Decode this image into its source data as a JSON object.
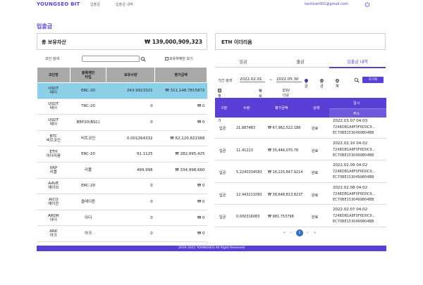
{
  "header": {
    "logo": "YOUNGSEO BIT",
    "nav": [
      "입출금",
      "입출금 내역"
    ],
    "email": "testUser001@gmail.com"
  },
  "page_title": "입출금",
  "left": {
    "total_assets_label": "총 보유자산",
    "total_assets_value": "₩ 139,000,909,323",
    "search_label": "코인 검색",
    "search_value": "",
    "holdings_only_label": "보유하에만 보기",
    "columns": [
      "코인명",
      "블록체인\n타입",
      "보유수량",
      "평가금액"
    ],
    "rows": [
      {
        "name": "USDT\n테더",
        "chain": "ERC-20",
        "qty": "243.9923321",
        "value": "₩ 311,148.7815872",
        "selected": true
      },
      {
        "name": "USDT\n테더",
        "chain": "TRC-20",
        "qty": "0",
        "value": "₩ 0",
        "selected": false
      },
      {
        "name": "USDT\n테더",
        "chain": "BEP20(BSC)",
        "qty": "0",
        "value": "₩ 0",
        "selected": false
      },
      {
        "name": "BTC\n비트코인",
        "chain": "비트코인",
        "qty": "0.001264332",
        "value": "₩ 62,120.822368",
        "selected": false
      },
      {
        "name": "ETH\n이더리움",
        "chain": "ERC-20",
        "qty": "91.1125",
        "value": "₩ 282,995,425",
        "selected": false
      },
      {
        "name": "XRP\n리플",
        "chain": "리플",
        "qty": "499,998",
        "value": "₩ 334,998,660",
        "selected": false
      },
      {
        "name": "AAVE\n에이브",
        "chain": "ERC-20",
        "qty": "0",
        "value": "₩ 0",
        "selected": false
      },
      {
        "name": "AICO\n에이콘",
        "chain": "클레이튼",
        "qty": "0",
        "value": "₩ 0",
        "selected": false
      },
      {
        "name": "ARDR\n아더",
        "chain": "아더",
        "qty": "0",
        "value": "₩ 0",
        "selected": false
      },
      {
        "name": "ARK\n아크",
        "chain": "아크",
        "qty": "0",
        "value": "₩ 0",
        "selected": false
      }
    ]
  },
  "right": {
    "title": "ETH 이더리움",
    "tabs": [
      "입금",
      "출금",
      "입출금 내역"
    ],
    "active_tab": 2,
    "period_label": "기간 검색",
    "date_from": "2022.02.01",
    "date_sep": "~",
    "date_to": "2022.05.30",
    "radios": [
      "입금",
      "출금",
      "전체"
    ],
    "search_button": "조기화",
    "pending_label": "진행 항목만 보기",
    "refresh_label": "새로고침",
    "csv_label": "CSV 다운로드",
    "hist_columns": [
      "구분",
      "수량",
      "평가금액",
      "상태",
      "일시",
      "주소"
    ],
    "history": [
      {
        "type": "입금",
        "qty": "21.887483",
        "value": "₩ 67,982,522.188",
        "status": "완료",
        "date": "2022.03.07 04:03",
        "addr1": "7248DB1A8F0F6D0C9...",
        "addr2": "EC70BE1530499804BB"
      },
      {
        "type": "입금",
        "qty": "11.41213",
        "value": "₩ 35,446,075.78",
        "status": "완료",
        "date": "2022.02.10 04:02",
        "addr1": "7248DB1A8F0F6D0C9...",
        "addr2": "EC70BE1530499804BB"
      },
      {
        "type": "입금",
        "qty": "5.2240334583",
        "value": "₩ 16,225,847.9214",
        "status": "완료",
        "date": "2022.02.09 04:02",
        "addr1": "7248DB1A8F0F6D0C9...",
        "addr2": "EC70BE1530499804BB"
      },
      {
        "type": "입금",
        "qty": "12.443211083",
        "value": "₩ 38,648,813.8237",
        "status": "완료",
        "date": "2022.02.08 04:02",
        "addr1": "7248DB1A8F0F6D0C9...",
        "addr2": "EC70BE1530499804BB"
      },
      {
        "type": "입금",
        "qty": "0.000316083",
        "value": "₩ 981.753798",
        "status": "완료",
        "date": "2022.02.07 04:02",
        "addr1": "7248DB1A8F0F6D0C9...",
        "addr2": "EC70BE1530499804BB"
      }
    ],
    "pager": {
      "first": "«",
      "prev": "‹",
      "current": "1",
      "next": "›",
      "last": "»"
    }
  },
  "footer": "2016-2021 YOUNGSEO All Right Reserved"
}
